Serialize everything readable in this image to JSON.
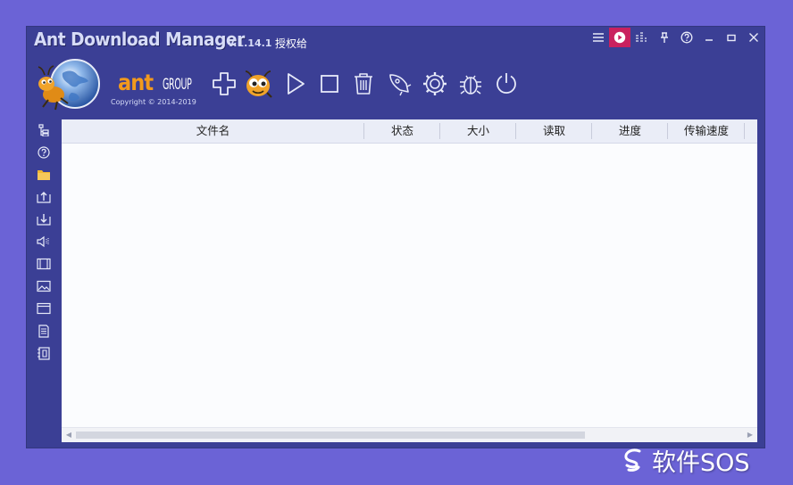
{
  "window": {
    "app_title": "Ant Download Manager",
    "version": "v.1.14.1",
    "license": "授权给",
    "copyright": "Copyright © 2014-2019",
    "brand_ant": "ant",
    "brand_group": "GROUP"
  },
  "title_controls": [
    {
      "name": "menu-icon"
    },
    {
      "name": "play-circle-icon",
      "active": true
    },
    {
      "name": "equalizer-icon"
    },
    {
      "name": "pin-icon"
    },
    {
      "name": "help-circle-icon"
    },
    {
      "name": "minimize-icon"
    },
    {
      "name": "maximize-icon"
    },
    {
      "name": "close-icon"
    }
  ],
  "toolbar": [
    {
      "name": "add-download-button",
      "icon": "plus-icon"
    },
    {
      "name": "ant-mascot-button",
      "icon": "ant-face-icon"
    },
    {
      "name": "resume-button",
      "icon": "play-icon"
    },
    {
      "name": "stop-button",
      "icon": "stop-icon"
    },
    {
      "name": "delete-button",
      "icon": "trash-icon"
    },
    {
      "name": "rocket-button",
      "icon": "rocket-icon"
    },
    {
      "name": "settings-button",
      "icon": "gear-icon"
    },
    {
      "name": "bug-report-button",
      "icon": "bug-icon"
    },
    {
      "name": "power-button",
      "icon": "power-icon"
    }
  ],
  "sidebar": [
    {
      "name": "sidebar-item-all",
      "icon": "tree-icon"
    },
    {
      "name": "sidebar-item-unknown",
      "icon": "help-icon"
    },
    {
      "name": "sidebar-item-folder",
      "icon": "folder-icon"
    },
    {
      "name": "sidebar-item-upload",
      "icon": "upload-icon"
    },
    {
      "name": "sidebar-item-download",
      "icon": "download-icon"
    },
    {
      "name": "sidebar-item-audio",
      "icon": "speaker-icon"
    },
    {
      "name": "sidebar-item-video",
      "icon": "film-icon"
    },
    {
      "name": "sidebar-item-images",
      "icon": "image-icon"
    },
    {
      "name": "sidebar-item-programs",
      "icon": "window-icon"
    },
    {
      "name": "sidebar-item-documents",
      "icon": "document-icon"
    },
    {
      "name": "sidebar-item-archives",
      "icon": "archive-icon"
    }
  ],
  "table": {
    "columns": [
      "文件名",
      "状态",
      "大小",
      "读取",
      "进度",
      "传输速度"
    ],
    "rows": []
  },
  "watermark": {
    "text": "软件SOS"
  },
  "colors": {
    "background": "#6b63d6",
    "window": "#3b3f95",
    "active_control": "#c9215f",
    "brand_orange": "#f29a1d"
  }
}
